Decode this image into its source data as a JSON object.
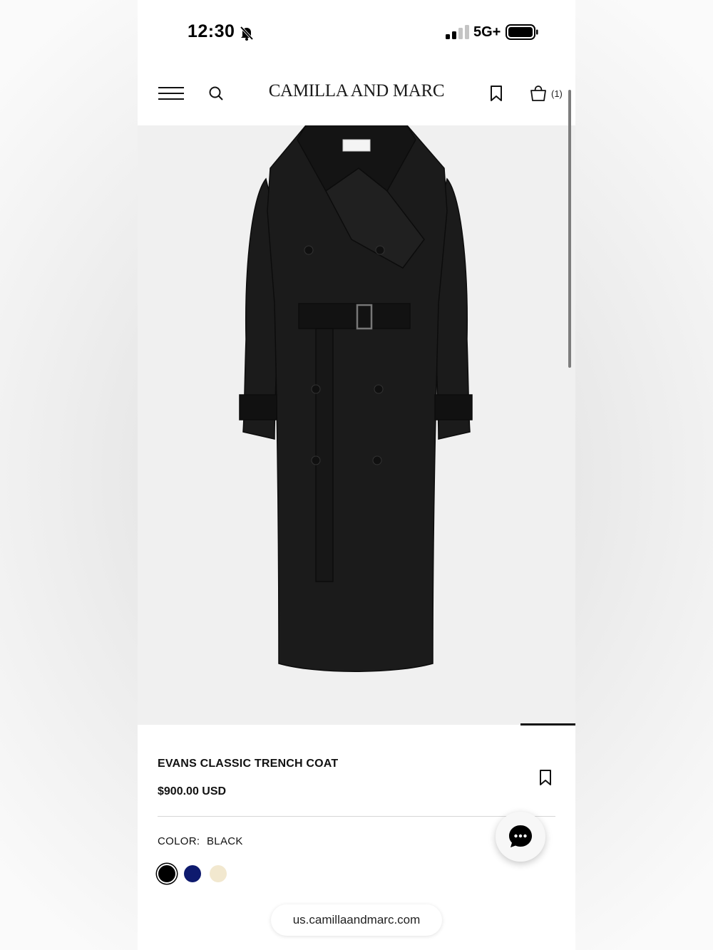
{
  "status_bar": {
    "time": "12:30",
    "network": "5G+",
    "icons": [
      "bell-slash-icon",
      "signal-icon",
      "battery-icon"
    ]
  },
  "header": {
    "brand": "CAMILLA AND MARC",
    "bag_count": "(1)",
    "icons": [
      "menu-icon",
      "search-icon",
      "bookmark-icon",
      "shopping-bag-icon"
    ]
  },
  "product": {
    "image_alt": "Black double-breasted trench coat with belt",
    "title": "EVANS CLASSIC TRENCH COAT",
    "price": "$900.00 USD",
    "color_label": "COLOR:",
    "color_value": "BLACK",
    "swatches": [
      {
        "name": "black",
        "color": "#000000",
        "selected": true
      },
      {
        "name": "navy",
        "color": "#0e1a6e",
        "selected": false
      },
      {
        "name": "cream",
        "color": "#f2e8cf",
        "selected": false
      }
    ]
  },
  "chat": {
    "icon": "chat-bubble-icon"
  },
  "browser": {
    "url": "us.camillaandmarc.com"
  },
  "colors": {
    "background": "#ffffff",
    "image_bg": "#f0f0f0",
    "text": "#111111"
  }
}
